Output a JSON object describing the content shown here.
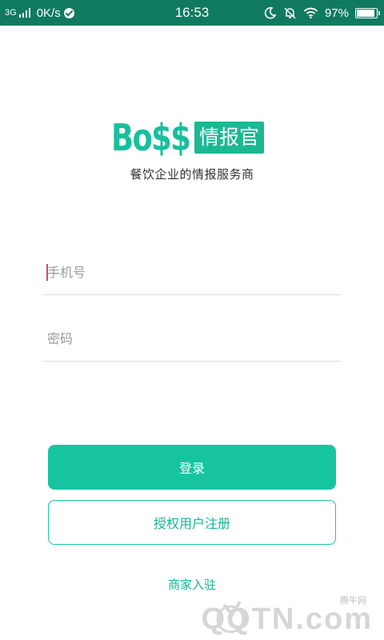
{
  "status_bar": {
    "network": "3G",
    "speed": "0K/s",
    "time": "16:53",
    "battery_percent": "97%",
    "battery_level": 0.97,
    "icons": [
      "signal-icon",
      "check-circle-icon",
      "moon-icon",
      "bell-off-icon",
      "wifi-icon",
      "battery-icon"
    ]
  },
  "logo": {
    "wordmark": "Bo$$",
    "tag": "情报官"
  },
  "slogan": "餐饮企业的情报服务商",
  "form": {
    "phone_placeholder": "手机号",
    "password_placeholder": "密码"
  },
  "buttons": {
    "login": "登录",
    "register": "授权用户注册"
  },
  "merchant_link": "商家入驻",
  "watermark": {
    "small": "腾牛网",
    "big": "QQTN.com"
  },
  "colors": {
    "status_bar": "#107a5f",
    "brand": "#16c4a2",
    "cursor": "#d6457a"
  }
}
